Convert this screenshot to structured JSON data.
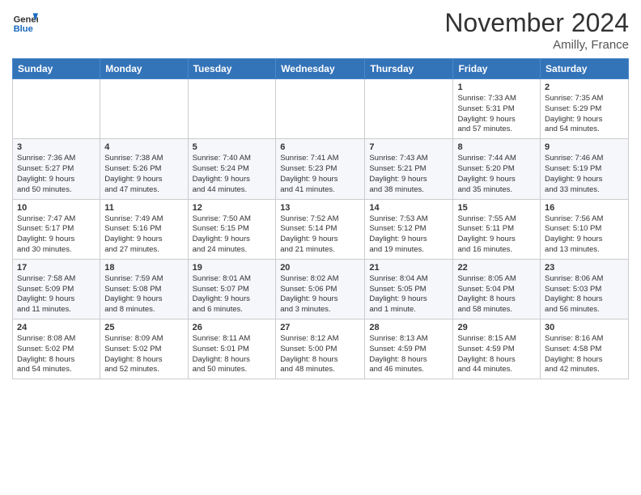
{
  "header": {
    "logo_general": "General",
    "logo_blue": "Blue",
    "month_year": "November 2024",
    "location": "Amilly, France"
  },
  "weekdays": [
    "Sunday",
    "Monday",
    "Tuesday",
    "Wednesday",
    "Thursday",
    "Friday",
    "Saturday"
  ],
  "weeks": [
    [
      {
        "day": "",
        "info": ""
      },
      {
        "day": "",
        "info": ""
      },
      {
        "day": "",
        "info": ""
      },
      {
        "day": "",
        "info": ""
      },
      {
        "day": "",
        "info": ""
      },
      {
        "day": "1",
        "info": "Sunrise: 7:33 AM\nSunset: 5:31 PM\nDaylight: 9 hours\nand 57 minutes."
      },
      {
        "day": "2",
        "info": "Sunrise: 7:35 AM\nSunset: 5:29 PM\nDaylight: 9 hours\nand 54 minutes."
      }
    ],
    [
      {
        "day": "3",
        "info": "Sunrise: 7:36 AM\nSunset: 5:27 PM\nDaylight: 9 hours\nand 50 minutes."
      },
      {
        "day": "4",
        "info": "Sunrise: 7:38 AM\nSunset: 5:26 PM\nDaylight: 9 hours\nand 47 minutes."
      },
      {
        "day": "5",
        "info": "Sunrise: 7:40 AM\nSunset: 5:24 PM\nDaylight: 9 hours\nand 44 minutes."
      },
      {
        "day": "6",
        "info": "Sunrise: 7:41 AM\nSunset: 5:23 PM\nDaylight: 9 hours\nand 41 minutes."
      },
      {
        "day": "7",
        "info": "Sunrise: 7:43 AM\nSunset: 5:21 PM\nDaylight: 9 hours\nand 38 minutes."
      },
      {
        "day": "8",
        "info": "Sunrise: 7:44 AM\nSunset: 5:20 PM\nDaylight: 9 hours\nand 35 minutes."
      },
      {
        "day": "9",
        "info": "Sunrise: 7:46 AM\nSunset: 5:19 PM\nDaylight: 9 hours\nand 33 minutes."
      }
    ],
    [
      {
        "day": "10",
        "info": "Sunrise: 7:47 AM\nSunset: 5:17 PM\nDaylight: 9 hours\nand 30 minutes."
      },
      {
        "day": "11",
        "info": "Sunrise: 7:49 AM\nSunset: 5:16 PM\nDaylight: 9 hours\nand 27 minutes."
      },
      {
        "day": "12",
        "info": "Sunrise: 7:50 AM\nSunset: 5:15 PM\nDaylight: 9 hours\nand 24 minutes."
      },
      {
        "day": "13",
        "info": "Sunrise: 7:52 AM\nSunset: 5:14 PM\nDaylight: 9 hours\nand 21 minutes."
      },
      {
        "day": "14",
        "info": "Sunrise: 7:53 AM\nSunset: 5:12 PM\nDaylight: 9 hours\nand 19 minutes."
      },
      {
        "day": "15",
        "info": "Sunrise: 7:55 AM\nSunset: 5:11 PM\nDaylight: 9 hours\nand 16 minutes."
      },
      {
        "day": "16",
        "info": "Sunrise: 7:56 AM\nSunset: 5:10 PM\nDaylight: 9 hours\nand 13 minutes."
      }
    ],
    [
      {
        "day": "17",
        "info": "Sunrise: 7:58 AM\nSunset: 5:09 PM\nDaylight: 9 hours\nand 11 minutes."
      },
      {
        "day": "18",
        "info": "Sunrise: 7:59 AM\nSunset: 5:08 PM\nDaylight: 9 hours\nand 8 minutes."
      },
      {
        "day": "19",
        "info": "Sunrise: 8:01 AM\nSunset: 5:07 PM\nDaylight: 9 hours\nand 6 minutes."
      },
      {
        "day": "20",
        "info": "Sunrise: 8:02 AM\nSunset: 5:06 PM\nDaylight: 9 hours\nand 3 minutes."
      },
      {
        "day": "21",
        "info": "Sunrise: 8:04 AM\nSunset: 5:05 PM\nDaylight: 9 hours\nand 1 minute."
      },
      {
        "day": "22",
        "info": "Sunrise: 8:05 AM\nSunset: 5:04 PM\nDaylight: 8 hours\nand 58 minutes."
      },
      {
        "day": "23",
        "info": "Sunrise: 8:06 AM\nSunset: 5:03 PM\nDaylight: 8 hours\nand 56 minutes."
      }
    ],
    [
      {
        "day": "24",
        "info": "Sunrise: 8:08 AM\nSunset: 5:02 PM\nDaylight: 8 hours\nand 54 minutes."
      },
      {
        "day": "25",
        "info": "Sunrise: 8:09 AM\nSunset: 5:02 PM\nDaylight: 8 hours\nand 52 minutes."
      },
      {
        "day": "26",
        "info": "Sunrise: 8:11 AM\nSunset: 5:01 PM\nDaylight: 8 hours\nand 50 minutes."
      },
      {
        "day": "27",
        "info": "Sunrise: 8:12 AM\nSunset: 5:00 PM\nDaylight: 8 hours\nand 48 minutes."
      },
      {
        "day": "28",
        "info": "Sunrise: 8:13 AM\nSunset: 4:59 PM\nDaylight: 8 hours\nand 46 minutes."
      },
      {
        "day": "29",
        "info": "Sunrise: 8:15 AM\nSunset: 4:59 PM\nDaylight: 8 hours\nand 44 minutes."
      },
      {
        "day": "30",
        "info": "Sunrise: 8:16 AM\nSunset: 4:58 PM\nDaylight: 8 hours\nand 42 minutes."
      }
    ]
  ]
}
